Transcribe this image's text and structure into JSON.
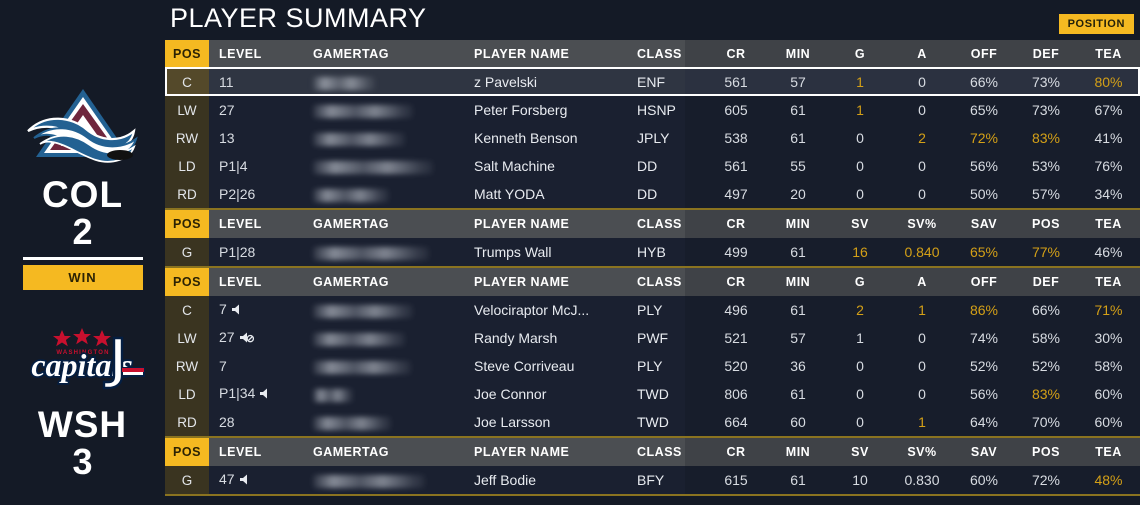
{
  "header": {
    "title": "PLAYER SUMMARY",
    "position_badge": "POSITION"
  },
  "colors": {
    "accent": "#f5b921",
    "gold_text": "#d4a017",
    "background": "#141a26",
    "row_background": "#1a2030",
    "header_background": "#4b4e52",
    "pos_cell_background": "#3a3420"
  },
  "sidebar": {
    "home": {
      "logo": "colorado-avalanche-logo",
      "abbr": "COL",
      "score": "2",
      "result": "WIN"
    },
    "away": {
      "logo": "washington-capitals-logo",
      "abbr": "WSH",
      "score": "3",
      "result": ""
    }
  },
  "headers": {
    "skater": [
      "POS",
      "LEVEL",
      "GAMERTAG",
      "PLAYER NAME",
      "CLASS",
      "CR",
      "MIN",
      "G",
      "A",
      "OFF",
      "DEF",
      "TEA"
    ],
    "goalie": [
      "POS",
      "LEVEL",
      "GAMERTAG",
      "PLAYER NAME",
      "CLASS",
      "CR",
      "MIN",
      "SV",
      "SV%",
      "SAV",
      "POS",
      "TEA"
    ]
  },
  "sections": [
    {
      "id": "home-skaters",
      "type": "skater",
      "rows": [
        {
          "pos": "C",
          "level": "11",
          "gamertag": "",
          "tag_width": 62,
          "speaker": "none",
          "name": "z Pavelski",
          "class": "ENF",
          "selected": true,
          "stats": [
            "561",
            "57",
            "1",
            "0",
            "66%",
            "73%",
            "80%"
          ],
          "gold": [
            false,
            false,
            true,
            false,
            false,
            false,
            true
          ]
        },
        {
          "pos": "LW",
          "level": "27",
          "gamertag": "",
          "tag_width": 100,
          "speaker": "none",
          "name": "Peter Forsberg",
          "class": "HSNP",
          "selected": false,
          "stats": [
            "605",
            "61",
            "1",
            "0",
            "65%",
            "73%",
            "67%"
          ],
          "gold": [
            false,
            false,
            true,
            false,
            false,
            false,
            false
          ]
        },
        {
          "pos": "RW",
          "level": "13",
          "gamertag": "",
          "tag_width": 92,
          "speaker": "none",
          "name": "Kenneth Benson",
          "class": "JPLY",
          "selected": false,
          "stats": [
            "538",
            "61",
            "0",
            "2",
            "72%",
            "83%",
            "41%"
          ],
          "gold": [
            false,
            false,
            false,
            true,
            true,
            true,
            false
          ]
        },
        {
          "pos": "LD",
          "level": "P1|4",
          "gamertag": "",
          "tag_width": 120,
          "speaker": "none",
          "name": "Salt Machine",
          "class": "DD",
          "selected": false,
          "stats": [
            "561",
            "55",
            "0",
            "0",
            "56%",
            "53%",
            "76%"
          ],
          "gold": [
            false,
            false,
            false,
            false,
            false,
            false,
            false
          ]
        },
        {
          "pos": "RD",
          "level": "P2|26",
          "gamertag": "",
          "tag_width": 76,
          "speaker": "none",
          "name": "Matt YODA",
          "class": "DD",
          "selected": false,
          "stats": [
            "497",
            "20",
            "0",
            "0",
            "50%",
            "57%",
            "34%"
          ],
          "gold": [
            false,
            false,
            false,
            false,
            false,
            false,
            false
          ]
        }
      ]
    },
    {
      "id": "home-goalie",
      "type": "goalie",
      "rows": [
        {
          "pos": "G",
          "level": "P1|28",
          "gamertag": "",
          "tag_width": 116,
          "speaker": "none",
          "name": "Trumps Wall",
          "class": "HYB",
          "selected": false,
          "stats": [
            "499",
            "61",
            "16",
            "0.840",
            "65%",
            "77%",
            "46%"
          ],
          "gold": [
            false,
            false,
            true,
            true,
            true,
            true,
            false
          ]
        }
      ]
    },
    {
      "id": "away-skaters",
      "type": "skater",
      "rows": [
        {
          "pos": "C",
          "level": "7",
          "gamertag": "",
          "tag_width": 100,
          "speaker": "on",
          "name": "Velociraptor McJ...",
          "class": "PLY",
          "selected": false,
          "stats": [
            "496",
            "61",
            "2",
            "1",
            "86%",
            "66%",
            "71%"
          ],
          "gold": [
            false,
            false,
            true,
            true,
            true,
            false,
            true
          ]
        },
        {
          "pos": "LW",
          "level": "27",
          "gamertag": "",
          "tag_width": 92,
          "speaker": "muted",
          "name": "Randy Marsh",
          "class": "PWF",
          "selected": false,
          "stats": [
            "521",
            "57",
            "1",
            "0",
            "74%",
            "58%",
            "30%"
          ],
          "gold": [
            false,
            false,
            false,
            false,
            false,
            false,
            false
          ]
        },
        {
          "pos": "RW",
          "level": "7",
          "gamertag": "",
          "tag_width": 98,
          "speaker": "none",
          "name": "Steve Corriveau",
          "class": "PLY",
          "selected": false,
          "stats": [
            "520",
            "36",
            "0",
            "0",
            "52%",
            "52%",
            "58%"
          ],
          "gold": [
            false,
            false,
            false,
            false,
            false,
            false,
            false
          ]
        },
        {
          "pos": "LD",
          "level": "P1|34",
          "gamertag": "",
          "tag_width": 40,
          "speaker": "on",
          "name": "Joe Connor",
          "class": "TWD",
          "selected": false,
          "stats": [
            "806",
            "61",
            "0",
            "0",
            "56%",
            "83%",
            "60%"
          ],
          "gold": [
            false,
            false,
            false,
            false,
            false,
            true,
            false
          ]
        },
        {
          "pos": "RD",
          "level": "28",
          "gamertag": "",
          "tag_width": 78,
          "speaker": "none",
          "name": "Joe Larsson",
          "class": "TWD",
          "selected": false,
          "stats": [
            "664",
            "60",
            "0",
            "1",
            "64%",
            "70%",
            "60%"
          ],
          "gold": [
            false,
            false,
            false,
            true,
            false,
            false,
            false
          ]
        }
      ]
    },
    {
      "id": "away-goalie",
      "type": "goalie",
      "rows": [
        {
          "pos": "G",
          "level": "47",
          "gamertag": "",
          "tag_width": 112,
          "speaker": "on",
          "name": "Jeff Bodie",
          "class": "BFY",
          "selected": false,
          "stats": [
            "615",
            "61",
            "10",
            "0.830",
            "60%",
            "72%",
            "48%"
          ],
          "gold": [
            false,
            false,
            false,
            false,
            false,
            false,
            true
          ]
        }
      ]
    }
  ]
}
